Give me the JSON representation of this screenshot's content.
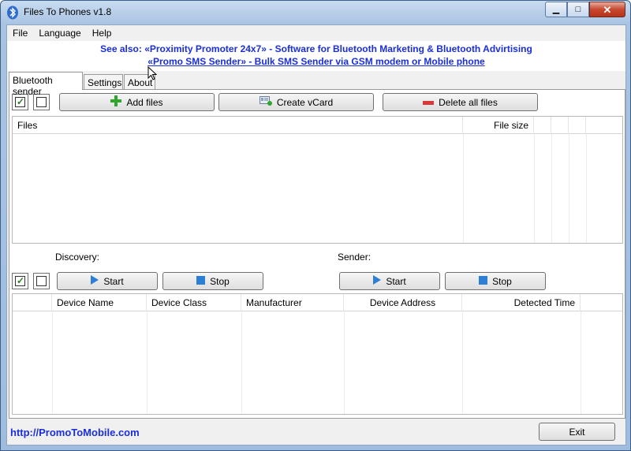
{
  "window": {
    "title": "Files To Phones v1.8"
  },
  "menu": {
    "items": [
      "File",
      "Language",
      "Help"
    ]
  },
  "banner": {
    "link1": "See also: «Proximity Promoter 24x7» - Software for Bluetooth Marketing & Bluetooth Advirtising",
    "link2": "«Promo SMS Sender» - Bulk SMS Sender via GSM modem or Mobile phone"
  },
  "tabs": [
    {
      "label": "Bluetooth sender",
      "active": true
    },
    {
      "label": "Settings",
      "active": false
    },
    {
      "label": "About",
      "active": false
    }
  ],
  "files_toolbar": {
    "add_files": "Add files",
    "create_vcard": "Create vCard",
    "delete_all_files": "Delete all files",
    "check_all_checked": true,
    "check_none_checked": false
  },
  "files_table": {
    "columns": [
      "Files",
      "File size"
    ],
    "rows": []
  },
  "discovery": {
    "label": "Discovery:",
    "start": "Start",
    "stop": "Stop",
    "check_all_checked": true,
    "check_none_checked": false
  },
  "sender": {
    "label": "Sender:",
    "start": "Start",
    "stop": "Stop"
  },
  "devices_table": {
    "columns": [
      "",
      "Device Name",
      "Device Class",
      "Manufacturer",
      "Device Address",
      "Detected Time"
    ],
    "rows": []
  },
  "footer": {
    "link": "http://PromoToMobile.com",
    "exit": "Exit"
  },
  "colors": {
    "link": "#1a2edb",
    "close_button": "#c7482f",
    "add_icon": "#2fa42f",
    "delete_icon": "#d63a3a",
    "play_icon": "#2d7fd6"
  }
}
